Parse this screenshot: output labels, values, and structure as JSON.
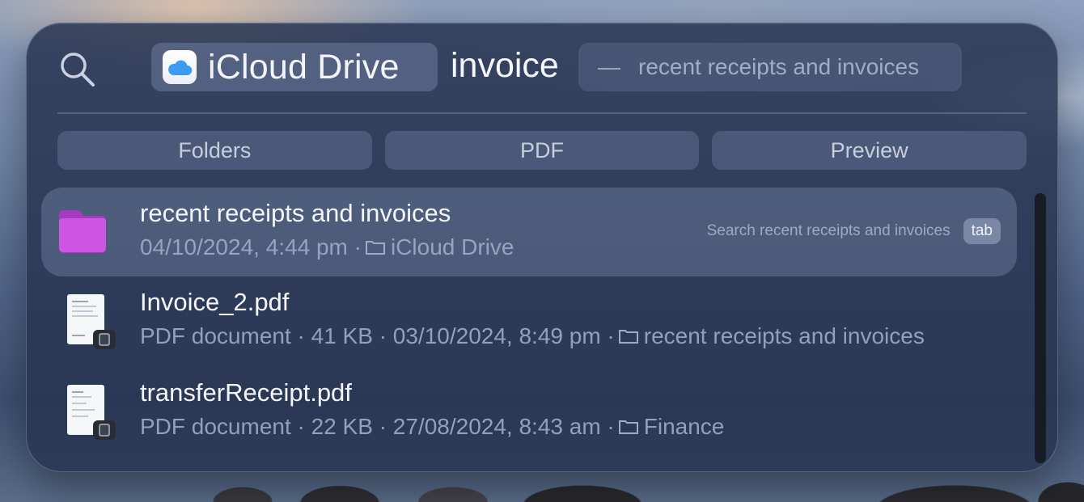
{
  "search": {
    "scope": "iCloud Drive",
    "query": "invoice",
    "suggestion": "recent receipts and invoices",
    "suggestion_dash": "—"
  },
  "filters": [
    "Folders",
    "PDF",
    "Preview"
  ],
  "results": [
    {
      "title": "recent receipts and invoices",
      "meta_prefix": "04/10/2024, 4:44 pm ·",
      "location": "iCloud Drive",
      "hint": "Search recent receipts and invoices",
      "hint_key": "tab",
      "icon": "purple-folder-icon"
    },
    {
      "title": "Invoice_2.pdf",
      "meta_prefix": "PDF document · 41 KB · 03/10/2024, 8:49 pm ·",
      "location": "recent receipts and invoices",
      "icon": "pdf-document-icon"
    },
    {
      "title": "transferReceipt.pdf",
      "meta_prefix": "PDF document · 22 KB · 27/08/2024, 8:43 am ·",
      "location": "Finance",
      "icon": "pdf-document-icon"
    }
  ],
  "colors": {
    "folder_purple": "#c94ee0",
    "panel_bg": "#283452",
    "icloud_blue": "#3a9bf0"
  }
}
